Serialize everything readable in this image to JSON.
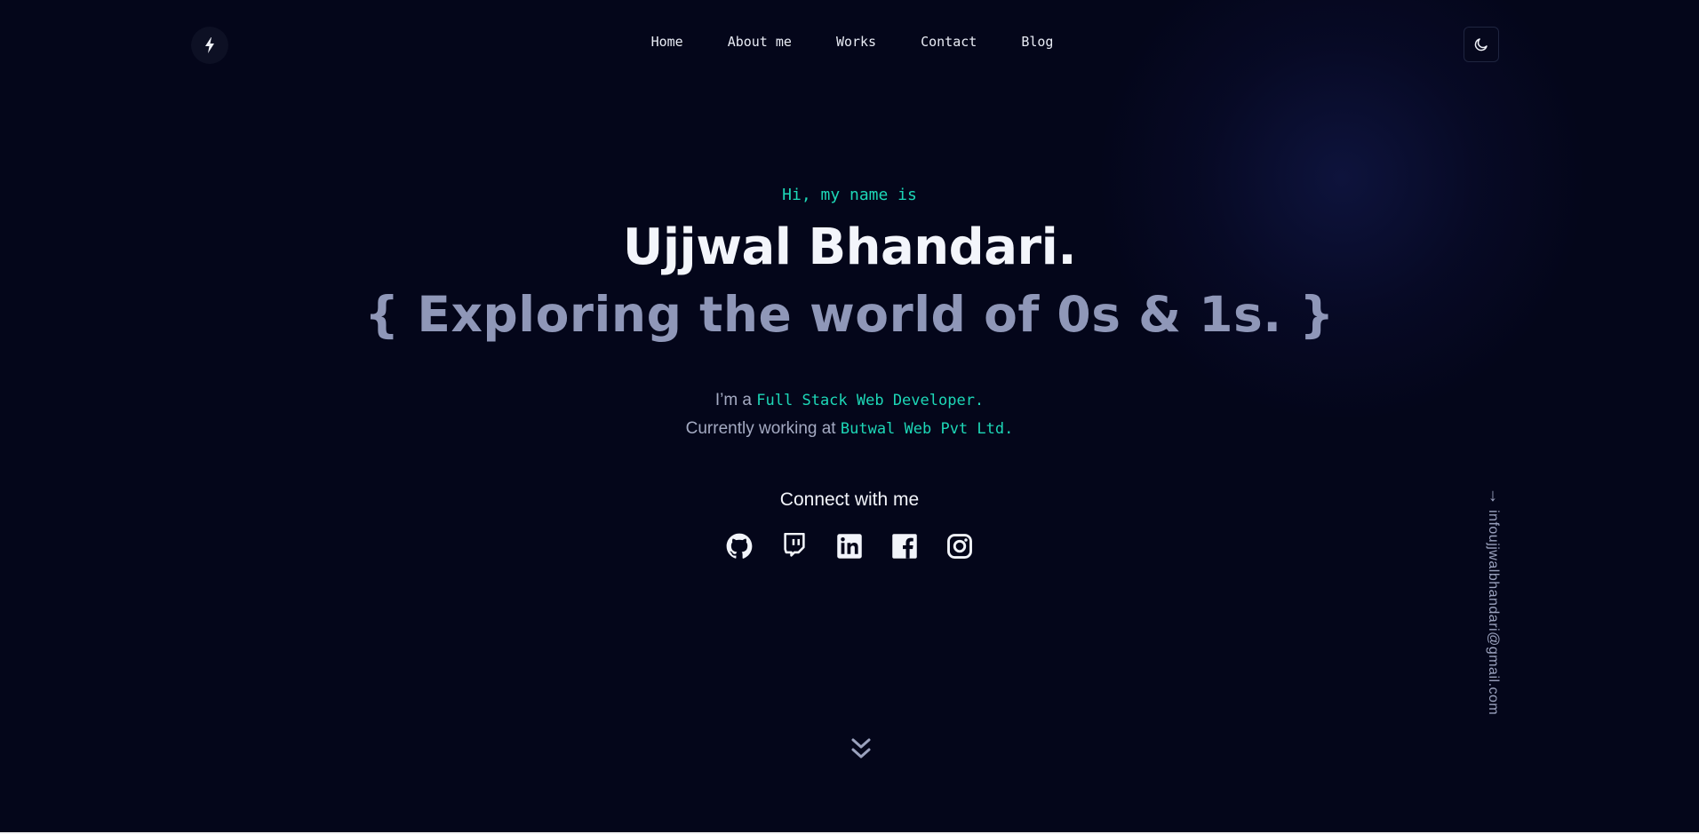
{
  "header": {
    "logo_icon": "lightning-bolt-icon",
    "nav": [
      "Home",
      "About me",
      "Works",
      "Contact",
      "Blog"
    ],
    "theme_toggle_icon": "moon-icon"
  },
  "hero": {
    "greeting": "Hi, my name is",
    "name": "Ujjwal Bhandari.",
    "tagline": "{ Exploring the world of 0s & 1s. }",
    "role_prefix": "I’m a",
    "role": "Full Stack Web Developer.",
    "work_prefix": "Currently working at",
    "company": "Butwal Web Pvt Ltd."
  },
  "connect": {
    "title": "Connect with me",
    "icons": [
      "github-icon",
      "twitch-icon",
      "linkedin-icon",
      "facebook-icon",
      "instagram-icon"
    ]
  },
  "side": {
    "arrow": "↓",
    "email": "infoujjwalbhandari@gmail.com"
  },
  "scroll_icon": "double-chevron-down-icon",
  "colors": {
    "background": "#04061a",
    "accent": "#1dd7b7",
    "muted": "#8f97b8"
  }
}
